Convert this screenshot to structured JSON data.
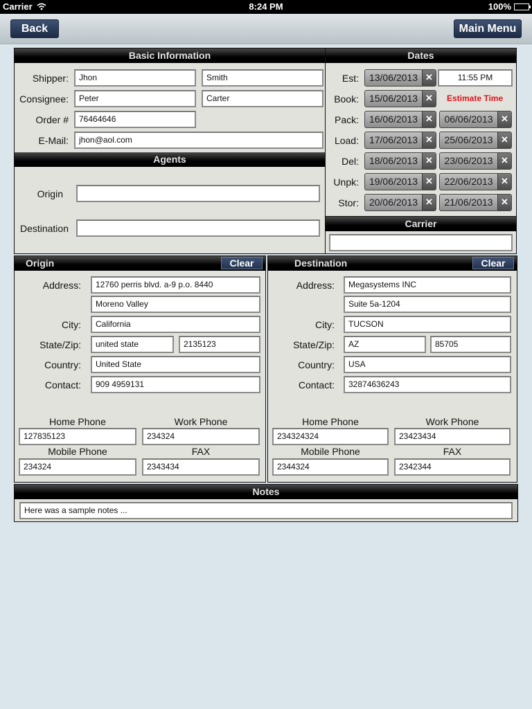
{
  "status_bar": {
    "carrier": "Carrier",
    "time": "8:24 PM",
    "battery": "100%"
  },
  "nav": {
    "back_label": "Back",
    "main_menu_label": "Main Menu"
  },
  "basic_info": {
    "title": "Basic Information",
    "shipper_label": "Shipper:",
    "shipper_first": "Jhon",
    "shipper_last": "Smith",
    "consignee_label": "Consignee:",
    "consignee_first": "Peter",
    "consignee_last": "Carter",
    "order_label": "Order #",
    "order_value": "76464646",
    "email_label": "E-Mail:",
    "email_value": "jhon@aol.com"
  },
  "agents": {
    "title": "Agents",
    "origin_label": "Origin",
    "origin_value": "",
    "destination_label": "Destination",
    "destination_value": ""
  },
  "dates": {
    "title": "Dates",
    "est_label": "Est:",
    "est_date": "13/06/2013",
    "est_time": "11:55 PM",
    "book_label": "Book:",
    "book_date": "15/06/2013",
    "estimate_time_label": "Estimate Time",
    "rows": [
      {
        "label": "Pack:",
        "from": "16/06/2013",
        "to": "06/06/2013"
      },
      {
        "label": "Load:",
        "from": "17/06/2013",
        "to": "25/06/2013"
      },
      {
        "label": "Del:",
        "from": "18/06/2013",
        "to": "23/06/2013"
      },
      {
        "label": "Unpk:",
        "from": "19/06/2013",
        "to": "22/06/2013"
      },
      {
        "label": "Stor:",
        "from": "20/06/2013",
        "to": "21/06/2013"
      }
    ],
    "clear_glyph": "✕"
  },
  "carrier": {
    "title": "Carrier",
    "value": ""
  },
  "origin": {
    "title": "Origin",
    "clear_label": "Clear",
    "address_label": "Address:",
    "address1": "12760 perris blvd. a-9 p.o. 8440",
    "address2": "Moreno Valley",
    "city_label": "City:",
    "city": "California",
    "statezip_label": "State/Zip:",
    "state": "united state",
    "zip": "2135123",
    "country_label": "Country:",
    "country": "United State",
    "contact_label": "Contact:",
    "contact": "909 4959131",
    "home_phone_label": "Home Phone",
    "home_phone": "127835123",
    "work_phone_label": "Work Phone",
    "work_phone": "234324",
    "mobile_phone_label": "Mobile Phone",
    "mobile_phone": "234324",
    "fax_label": "FAX",
    "fax": "2343434"
  },
  "destination": {
    "title": "Destination",
    "clear_label": "Clear",
    "address_label": "Address:",
    "address1": "Megasystems INC",
    "address2": "Suite 5a-1204",
    "city_label": "City:",
    "city": "TUCSON",
    "statezip_label": "State/Zip:",
    "state": "AZ",
    "zip": "85705",
    "country_label": "Country:",
    "country": "USA",
    "contact_label": "Contact:",
    "contact": "32874636243",
    "home_phone_label": "Home Phone",
    "home_phone": "234324324",
    "work_phone_label": "Work Phone",
    "work_phone": "23423434",
    "mobile_phone_label": "Mobile Phone",
    "mobile_phone": "2344324",
    "fax_label": "FAX",
    "fax": "2342344"
  },
  "notes": {
    "title": "Notes",
    "value": "Here was a sample notes ..."
  }
}
